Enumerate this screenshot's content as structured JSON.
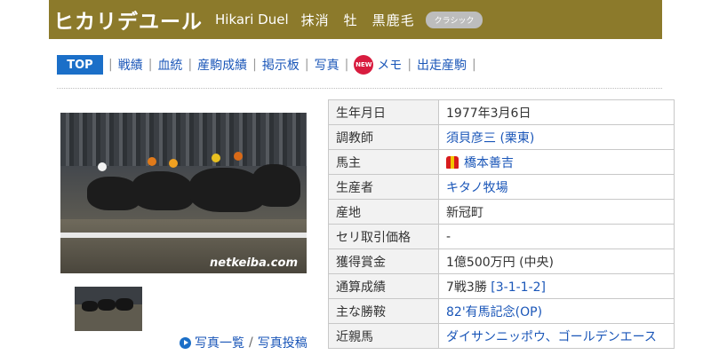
{
  "header": {
    "name_jp": "ヒカリデユール",
    "name_en": "Hikari Duel",
    "status": "抹消　牡　黒鹿毛",
    "class_badge": "クラシック",
    "bg_color": "#8c7a2b"
  },
  "nav": {
    "top": "TOP",
    "items": [
      "戦績",
      "血統",
      "産駒成績",
      "掲示板",
      "写真"
    ],
    "new_badge": "NEW",
    "memo": "メモ",
    "last": "出走産駒"
  },
  "photo": {
    "caption": "netkeiba.com",
    "links": [
      "写真一覧",
      "写真投稿"
    ]
  },
  "info": {
    "rows": [
      {
        "label": "生年月日",
        "value": "1977年3月6日"
      },
      {
        "label": "調教師",
        "value": "須貝彦三 (栗東)"
      },
      {
        "label": "馬主",
        "value": "橋本善吉"
      },
      {
        "label": "生産者",
        "value": "キタノ牧場"
      },
      {
        "label": "産地",
        "value": "新冠町"
      },
      {
        "label": "セリ取引価格",
        "value": "-"
      },
      {
        "label": "獲得賞金",
        "value": "1億500万円 (中央)"
      },
      {
        "label": "通算成績",
        "value": "7戦3勝",
        "value_link": "[3-1-1-2]"
      },
      {
        "label": "主な勝鞍",
        "value": "82'有馬記念(OP)"
      },
      {
        "label": "近親馬",
        "value": "ダイサンニッポウ、ゴールデンエース"
      }
    ]
  },
  "colors": {
    "link": "#1a56b8",
    "top_tab": "#1b6fc8",
    "new_badge": "#d81c3f"
  }
}
